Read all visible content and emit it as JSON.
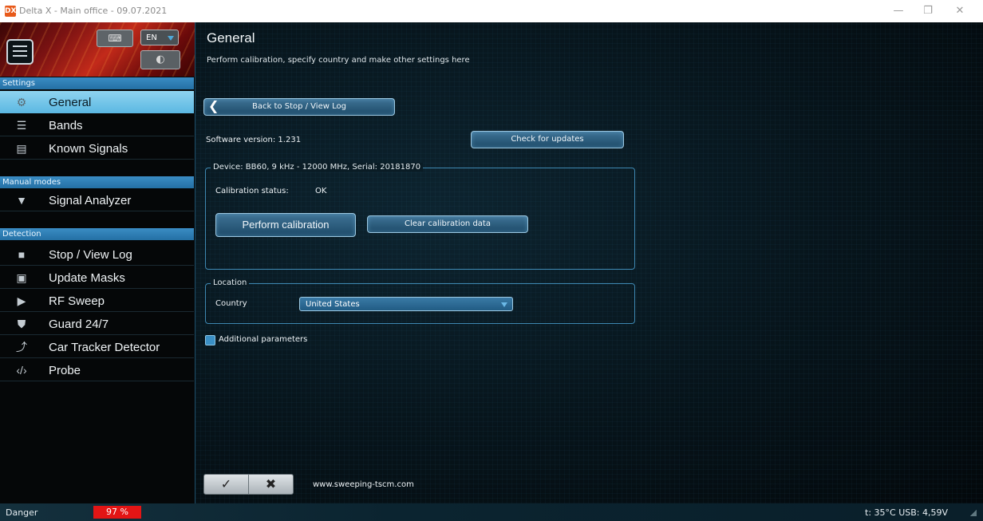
{
  "window": {
    "title": "Delta X - Main office - 09.07.2021",
    "app_icon_text": "DX",
    "minimize": "—",
    "maximize": "❐",
    "close": "✕"
  },
  "banner": {
    "keyboard_icon": "⌨",
    "language": "EN",
    "theme_icon": "◐"
  },
  "sidebar": {
    "sections": [
      {
        "title": "Settings",
        "items": [
          {
            "label": "General",
            "icon": "gear-icon"
          },
          {
            "label": "Bands",
            "icon": "list-icon"
          },
          {
            "label": "Known Signals",
            "icon": "clipboard-icon"
          }
        ]
      },
      {
        "title": "Manual modes",
        "items": [
          {
            "label": "Signal Analyzer",
            "icon": "signal-icon"
          }
        ]
      },
      {
        "title": "Detection",
        "items": [
          {
            "label": "Stop / View Log",
            "icon": "stop-icon"
          },
          {
            "label": "Update Masks",
            "icon": "image-icon"
          },
          {
            "label": "RF Sweep",
            "icon": "play-icon"
          },
          {
            "label": "Guard 24/7",
            "icon": "shield-icon"
          },
          {
            "label": "Car Tracker Detector",
            "icon": "trend-icon"
          },
          {
            "label": "Probe",
            "icon": "code-icon"
          }
        ]
      }
    ],
    "active_item": "General"
  },
  "main": {
    "title": "General",
    "subtitle": "Perform calibration, specify country and make other settings here",
    "back_button": "Back to Stop / View Log",
    "software_version_label": "Software version: 1.231",
    "check_updates_button": "Check for updates",
    "device_group": {
      "legend": "Device: BB60, 9 kHz - 12000 MHz, Serial: 20181870",
      "calibration_status_label": "Calibration status:",
      "calibration_status_value": "OK",
      "perform_calibration_button": "Perform calibration",
      "clear_calibration_button": "Clear calibration data"
    },
    "location_group": {
      "legend": "Location",
      "country_label": "Country",
      "country_value": "United States"
    },
    "additional_parameters_label": "Additional parameters",
    "additional_parameters_checked": false,
    "ok_button": "✓",
    "cancel_button": "✖",
    "website": "www.sweeping-tscm.com"
  },
  "statusbar": {
    "label": "Danger",
    "danger_value": "97 %",
    "danger_color": "#e31515",
    "right_text": "t: 35°C USB: 4,59V"
  },
  "colors": {
    "accent": "#5bb7e2",
    "section_header": "#2a7bb2",
    "button": "#2d5f82"
  }
}
